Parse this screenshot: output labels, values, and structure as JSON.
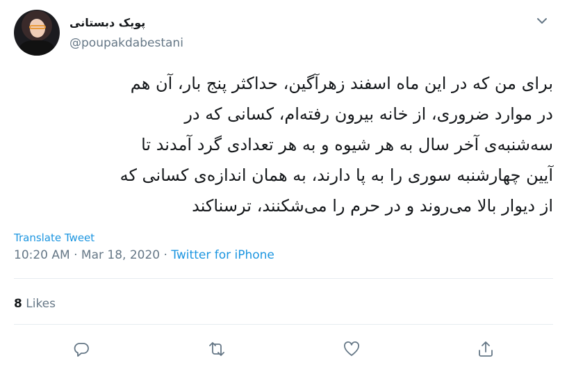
{
  "author": {
    "display_name": "پویک دبستانی",
    "handle": "@poupakdabestani"
  },
  "tweet": {
    "lines": [
      "برای من که در این ماه اسفند زهرآگین، حداکثر پنج بار، آن هم",
      "در موارد ضروری، از خانه بیرون رفته‌ام، کسانی که در",
      "سه‌شنبه‌ی آخر سال به هر شیوه و به هر تعدادی گرد آمدند تا",
      "آیین چهارشنبه سوری را به پا دارند، به همان اندازه‌ی کسانی که",
      "از دیوار بالا می‌روند و در حرم را می‌شکنند، ترسناکند"
    ],
    "translate_label": "Translate Tweet",
    "time": "10:20 AM",
    "separator": " · ",
    "date": "Mar 18, 2020",
    "source": "Twitter for iPhone"
  },
  "stats": {
    "likes_count": "8",
    "likes_label": " Likes"
  },
  "icons": {
    "reply": "reply-icon",
    "retweet": "retweet-icon",
    "like": "heart-icon",
    "share": "share-icon",
    "menu": "chevron-down-icon"
  },
  "colors": {
    "link": "#1b95e0",
    "muted": "#657786",
    "text": "#14171a",
    "divider": "#e6ecf0"
  }
}
